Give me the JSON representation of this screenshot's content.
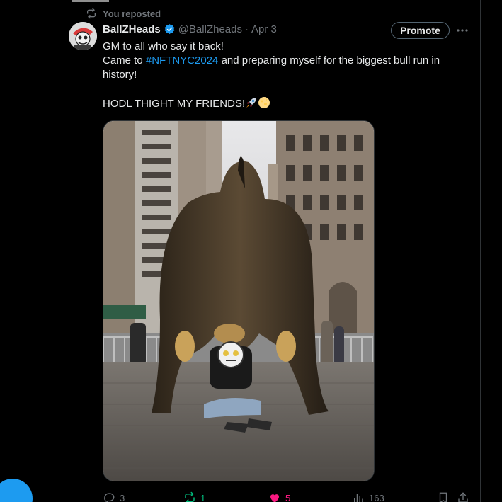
{
  "repost_banner": {
    "label": "You reposted",
    "icon": "repost-icon"
  },
  "author": {
    "display_name": "BallZHeads",
    "handle": "@BallZheads",
    "separator": "·",
    "date": "Apr 3",
    "verified": true
  },
  "promote_label": "Promote",
  "tweet": {
    "line1": "GM to all who say it back!",
    "line2_before": "Came to ",
    "hashtag": "#NFTNYC2024",
    "line2_after": " and preparing myself for the biggest bull run in",
    "line3": "history!",
    "line4": "HODL THIGHT MY FRIENDS!",
    "emojis": [
      "rocket-emoji",
      "moon-emoji"
    ]
  },
  "actions": {
    "replies": "3",
    "reposts": "1",
    "likes": "5",
    "views": "163"
  },
  "colors": {
    "accent": "#1d9bf0",
    "repost_green": "#00ba7c",
    "like_pink": "#f91880",
    "muted": "#71767b",
    "text": "#e7e9ea"
  }
}
